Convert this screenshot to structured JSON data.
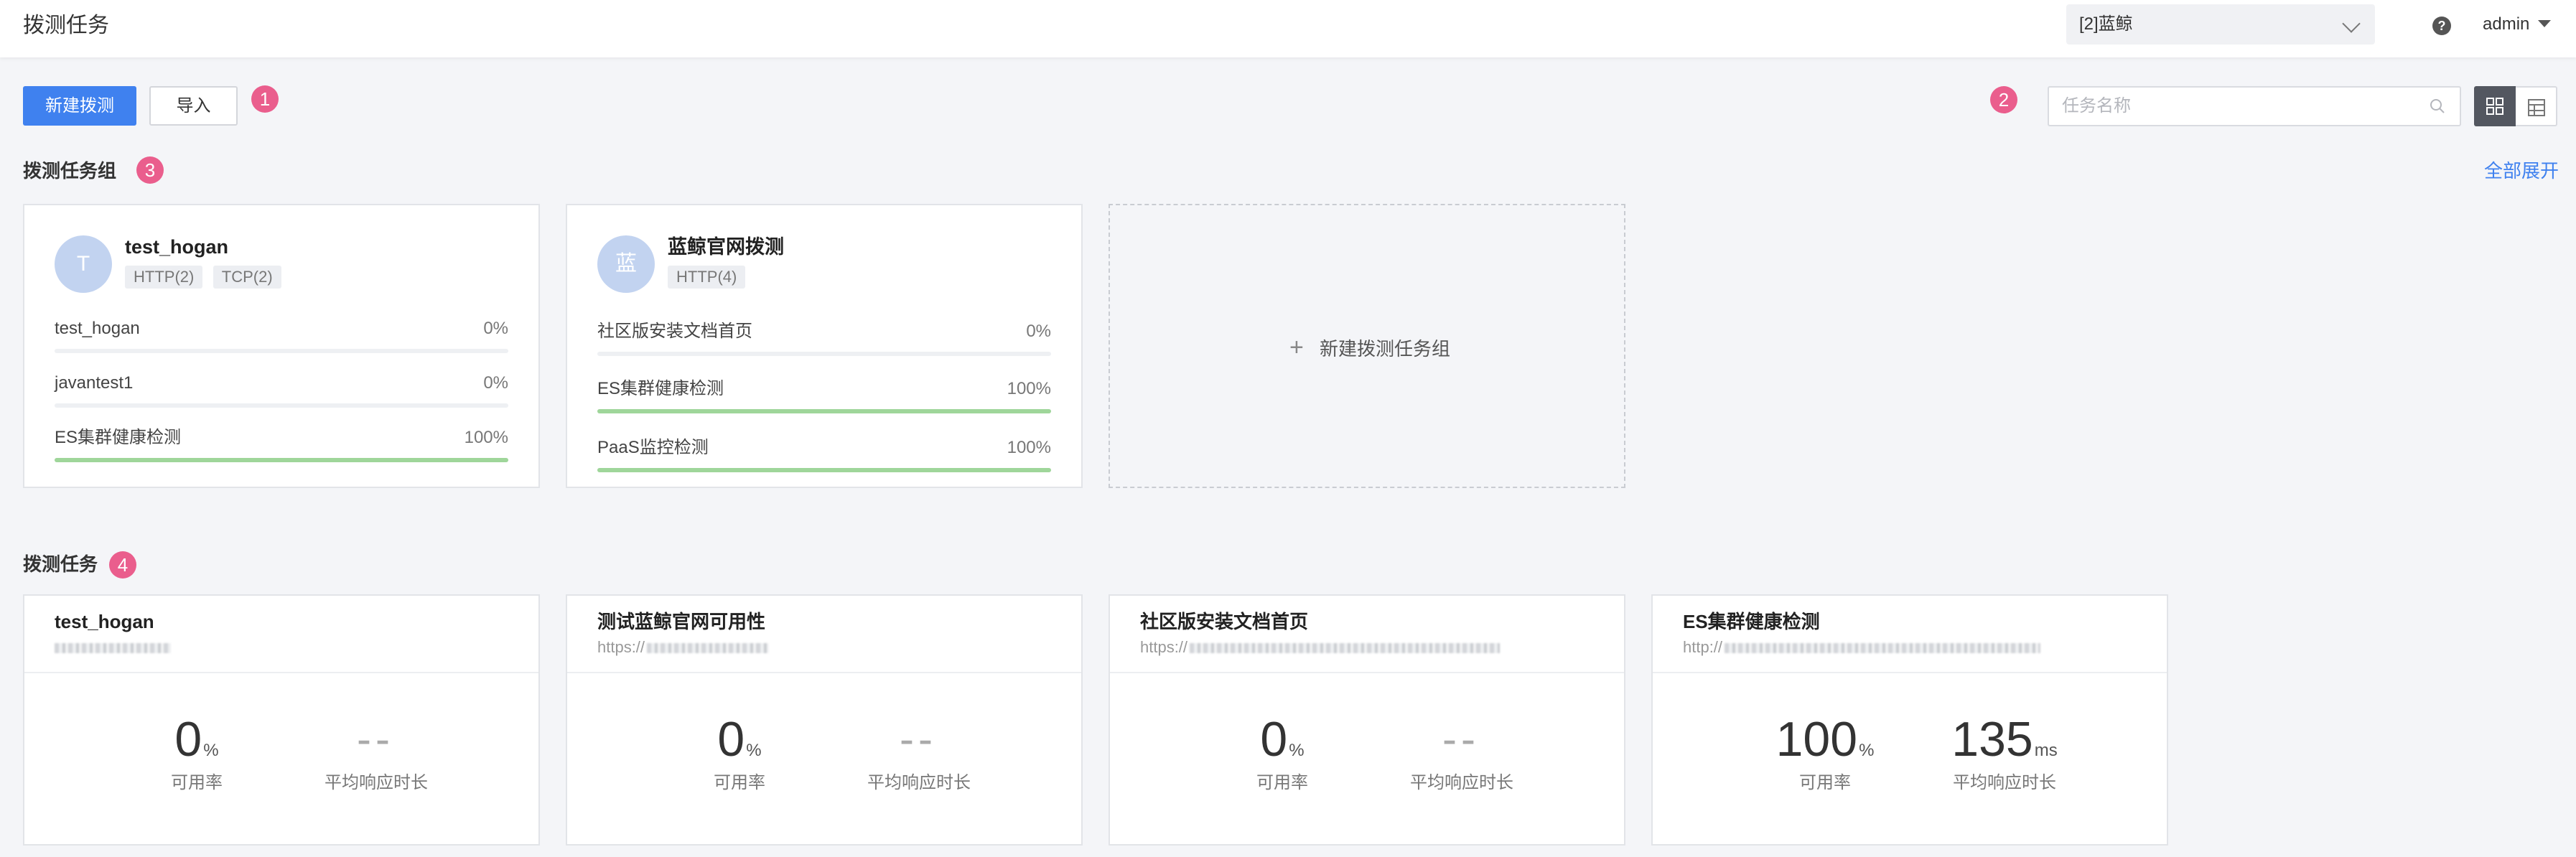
{
  "header": {
    "title": "拨测任务",
    "team_select": "[2]蓝鲸",
    "help_icon": "?",
    "user": "admin"
  },
  "toolbar": {
    "new_button": "新建拨测",
    "import_button": "导入",
    "search_placeholder": "任务名称"
  },
  "markers": [
    "1",
    "2",
    "3",
    "4"
  ],
  "groups_section": {
    "title": "拨测任务组",
    "expand_all": "全部展开",
    "new_group": "新建拨测任务组",
    "new_group_plus": "+",
    "groups": [
      {
        "avatar": "T",
        "name": "test_hogan",
        "tags": [
          "HTTP(2)",
          "TCP(2)"
        ],
        "tasks": [
          {
            "name": "test_hogan",
            "pct_label": "0%",
            "pct": 0
          },
          {
            "name": "javantest1",
            "pct_label": "0%",
            "pct": 0
          },
          {
            "name": "ES集群健康检测",
            "pct_label": "100%",
            "pct": 100
          }
        ]
      },
      {
        "avatar": "蓝",
        "name": "蓝鲸官网拨测",
        "tags": [
          "HTTP(4)"
        ],
        "tasks": [
          {
            "name": "社区版安装文档首页",
            "pct_label": "0%",
            "pct": 0
          },
          {
            "name": "ES集群健康检测",
            "pct_label": "100%",
            "pct": 100
          },
          {
            "name": "PaaS监控检测",
            "pct_label": "100%",
            "pct": 100
          }
        ]
      }
    ]
  },
  "tasks_section": {
    "title": "拨测任务",
    "availability_label": "可用率",
    "avg_response_label": "平均响应时长",
    "tasks": [
      {
        "name": "test_hogan",
        "address": "",
        "availability": "0",
        "availability_unit": "%",
        "response": "--",
        "response_unit": ""
      },
      {
        "name": "测试蓝鲸官网可用性",
        "address": "https://",
        "availability": "0",
        "availability_unit": "%",
        "response": "--",
        "response_unit": ""
      },
      {
        "name": "社区版安装文档首页",
        "address": "https://",
        "availability": "0",
        "availability_unit": "%",
        "response": "--",
        "response_unit": ""
      },
      {
        "name": "ES集群健康检测",
        "address": "http://",
        "availability": "100",
        "availability_unit": "%",
        "response": "135",
        "response_unit": "ms"
      }
    ]
  },
  "colors": {
    "primary": "#3f81ef",
    "marker": "#ea5e8d",
    "progress_fill": "#9fd69a",
    "avatar": "#c2d3f0"
  }
}
